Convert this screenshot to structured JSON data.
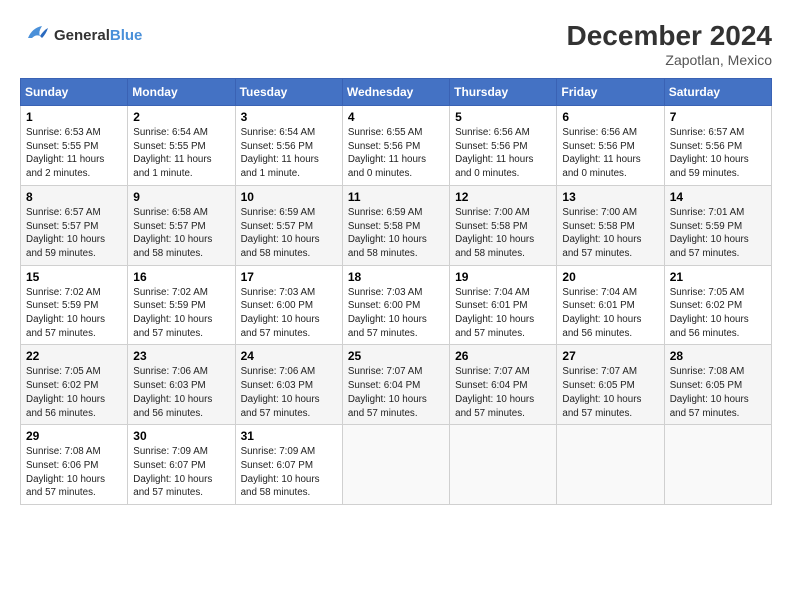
{
  "header": {
    "logo_line1": "General",
    "logo_line2": "Blue",
    "month": "December 2024",
    "location": "Zapotlan, Mexico"
  },
  "days_of_week": [
    "Sunday",
    "Monday",
    "Tuesday",
    "Wednesday",
    "Thursday",
    "Friday",
    "Saturday"
  ],
  "weeks": [
    [
      {
        "day": "1",
        "info": "Sunrise: 6:53 AM\nSunset: 5:55 PM\nDaylight: 11 hours\nand 2 minutes."
      },
      {
        "day": "2",
        "info": "Sunrise: 6:54 AM\nSunset: 5:55 PM\nDaylight: 11 hours\nand 1 minute."
      },
      {
        "day": "3",
        "info": "Sunrise: 6:54 AM\nSunset: 5:56 PM\nDaylight: 11 hours\nand 1 minute."
      },
      {
        "day": "4",
        "info": "Sunrise: 6:55 AM\nSunset: 5:56 PM\nDaylight: 11 hours\nand 0 minutes."
      },
      {
        "day": "5",
        "info": "Sunrise: 6:56 AM\nSunset: 5:56 PM\nDaylight: 11 hours\nand 0 minutes."
      },
      {
        "day": "6",
        "info": "Sunrise: 6:56 AM\nSunset: 5:56 PM\nDaylight: 11 hours\nand 0 minutes."
      },
      {
        "day": "7",
        "info": "Sunrise: 6:57 AM\nSunset: 5:56 PM\nDaylight: 10 hours\nand 59 minutes."
      }
    ],
    [
      {
        "day": "8",
        "info": "Sunrise: 6:57 AM\nSunset: 5:57 PM\nDaylight: 10 hours\nand 59 minutes."
      },
      {
        "day": "9",
        "info": "Sunrise: 6:58 AM\nSunset: 5:57 PM\nDaylight: 10 hours\nand 58 minutes."
      },
      {
        "day": "10",
        "info": "Sunrise: 6:59 AM\nSunset: 5:57 PM\nDaylight: 10 hours\nand 58 minutes."
      },
      {
        "day": "11",
        "info": "Sunrise: 6:59 AM\nSunset: 5:58 PM\nDaylight: 10 hours\nand 58 minutes."
      },
      {
        "day": "12",
        "info": "Sunrise: 7:00 AM\nSunset: 5:58 PM\nDaylight: 10 hours\nand 58 minutes."
      },
      {
        "day": "13",
        "info": "Sunrise: 7:00 AM\nSunset: 5:58 PM\nDaylight: 10 hours\nand 57 minutes."
      },
      {
        "day": "14",
        "info": "Sunrise: 7:01 AM\nSunset: 5:59 PM\nDaylight: 10 hours\nand 57 minutes."
      }
    ],
    [
      {
        "day": "15",
        "info": "Sunrise: 7:02 AM\nSunset: 5:59 PM\nDaylight: 10 hours\nand 57 minutes."
      },
      {
        "day": "16",
        "info": "Sunrise: 7:02 AM\nSunset: 5:59 PM\nDaylight: 10 hours\nand 57 minutes."
      },
      {
        "day": "17",
        "info": "Sunrise: 7:03 AM\nSunset: 6:00 PM\nDaylight: 10 hours\nand 57 minutes."
      },
      {
        "day": "18",
        "info": "Sunrise: 7:03 AM\nSunset: 6:00 PM\nDaylight: 10 hours\nand 57 minutes."
      },
      {
        "day": "19",
        "info": "Sunrise: 7:04 AM\nSunset: 6:01 PM\nDaylight: 10 hours\nand 57 minutes."
      },
      {
        "day": "20",
        "info": "Sunrise: 7:04 AM\nSunset: 6:01 PM\nDaylight: 10 hours\nand 56 minutes."
      },
      {
        "day": "21",
        "info": "Sunrise: 7:05 AM\nSunset: 6:02 PM\nDaylight: 10 hours\nand 56 minutes."
      }
    ],
    [
      {
        "day": "22",
        "info": "Sunrise: 7:05 AM\nSunset: 6:02 PM\nDaylight: 10 hours\nand 56 minutes."
      },
      {
        "day": "23",
        "info": "Sunrise: 7:06 AM\nSunset: 6:03 PM\nDaylight: 10 hours\nand 56 minutes."
      },
      {
        "day": "24",
        "info": "Sunrise: 7:06 AM\nSunset: 6:03 PM\nDaylight: 10 hours\nand 57 minutes."
      },
      {
        "day": "25",
        "info": "Sunrise: 7:07 AM\nSunset: 6:04 PM\nDaylight: 10 hours\nand 57 minutes."
      },
      {
        "day": "26",
        "info": "Sunrise: 7:07 AM\nSunset: 6:04 PM\nDaylight: 10 hours\nand 57 minutes."
      },
      {
        "day": "27",
        "info": "Sunrise: 7:07 AM\nSunset: 6:05 PM\nDaylight: 10 hours\nand 57 minutes."
      },
      {
        "day": "28",
        "info": "Sunrise: 7:08 AM\nSunset: 6:05 PM\nDaylight: 10 hours\nand 57 minutes."
      }
    ],
    [
      {
        "day": "29",
        "info": "Sunrise: 7:08 AM\nSunset: 6:06 PM\nDaylight: 10 hours\nand 57 minutes."
      },
      {
        "day": "30",
        "info": "Sunrise: 7:09 AM\nSunset: 6:07 PM\nDaylight: 10 hours\nand 57 minutes."
      },
      {
        "day": "31",
        "info": "Sunrise: 7:09 AM\nSunset: 6:07 PM\nDaylight: 10 hours\nand 58 minutes."
      },
      {
        "day": "",
        "info": ""
      },
      {
        "day": "",
        "info": ""
      },
      {
        "day": "",
        "info": ""
      },
      {
        "day": "",
        "info": ""
      }
    ]
  ]
}
